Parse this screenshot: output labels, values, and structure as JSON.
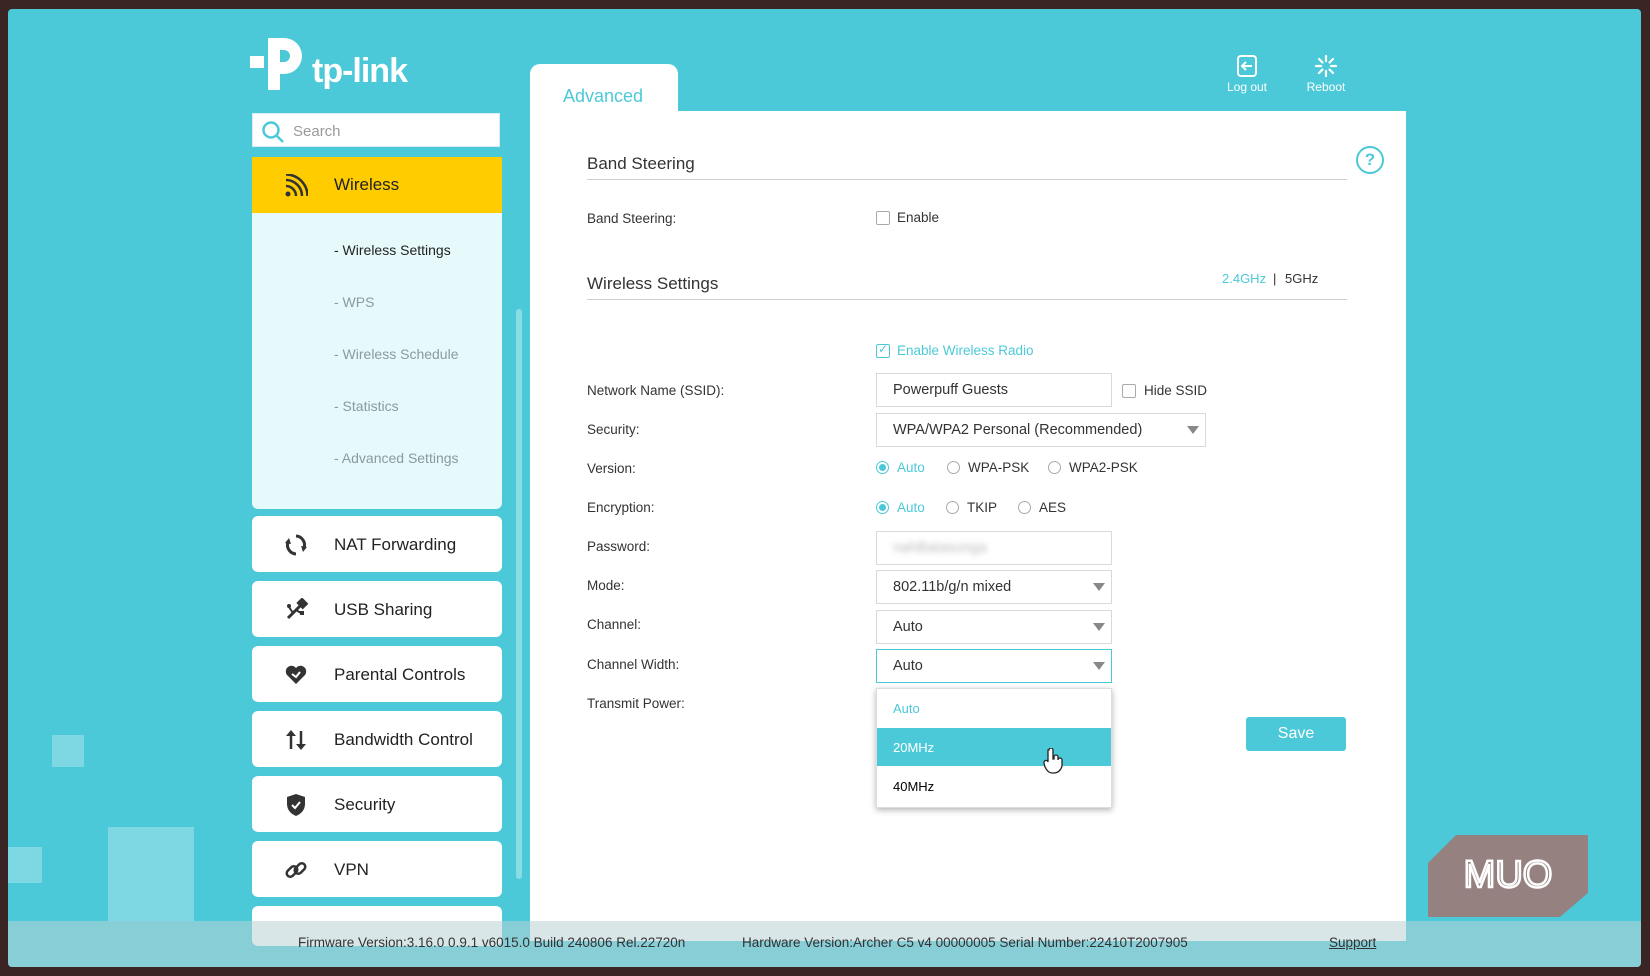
{
  "brand": {
    "name": "tp-link"
  },
  "search": {
    "placeholder": "Search"
  },
  "sidebar": {
    "wireless": {
      "label": "Wireless",
      "subitems": [
        "- Wireless Settings",
        "- WPS",
        "- Wireless Schedule",
        "- Statistics",
        "- Advanced Settings"
      ]
    },
    "items": [
      {
        "label": "NAT Forwarding",
        "icon": "nat-forwarding-icon"
      },
      {
        "label": "USB Sharing",
        "icon": "usb-icon"
      },
      {
        "label": "Parental Controls",
        "icon": "heart-icon"
      },
      {
        "label": "Bandwidth Control",
        "icon": "up-down-arrows-icon"
      },
      {
        "label": "Security",
        "icon": "shield-icon"
      },
      {
        "label": "VPN",
        "icon": "link-icon"
      }
    ]
  },
  "header": {
    "tab": "Advanced",
    "logout_label": "Log out",
    "reboot_label": "Reboot"
  },
  "band_steering": {
    "title": "Band Steering",
    "label": "Band Steering:",
    "enable_label": "Enable",
    "enabled": false
  },
  "wireless_settings": {
    "title": "Wireless Settings",
    "band_24": "2.4GHz",
    "separator": "|",
    "band_5": "5GHz",
    "enable_radio_label": "Enable Wireless Radio",
    "enable_radio": true,
    "ssid_label": "Network Name (SSID):",
    "ssid_value": "Powerpuff Guests",
    "hide_ssid_label": "Hide SSID",
    "security_label": "Security:",
    "security_value": "WPA/WPA2 Personal (Recommended)",
    "version_label": "Version:",
    "version_options": [
      "Auto",
      "WPA-PSK",
      "WPA2-PSK"
    ],
    "version_selected": "Auto",
    "encryption_label": "Encryption:",
    "encryption_options": [
      "Auto",
      "TKIP",
      "AES"
    ],
    "encryption_selected": "Auto",
    "password_label": "Password:",
    "password_value": "nahBatasunga",
    "mode_label": "Mode:",
    "mode_value": "802.11b/g/n mixed",
    "channel_label": "Channel:",
    "channel_value": "Auto",
    "channel_width_label": "Channel Width:",
    "channel_width_value": "Auto",
    "channel_width_options": [
      "Auto",
      "20MHz",
      "40MHz"
    ],
    "channel_width_highlighted": "20MHz",
    "transmit_power_label": "Transmit Power:",
    "save_label": "Save"
  },
  "footer": {
    "firmware": "Firmware Version:3.16.0 0.9.1 v6015.0 Build 240806 Rel.22720n",
    "hardware": "Hardware Version:Archer C5 v4 00000005 Serial Number:22410T2007905",
    "support": "Support"
  },
  "watermark": {
    "text": "MUO"
  },
  "colors": {
    "accent": "#4cc9d8",
    "active_nav": "#ffcc00"
  }
}
